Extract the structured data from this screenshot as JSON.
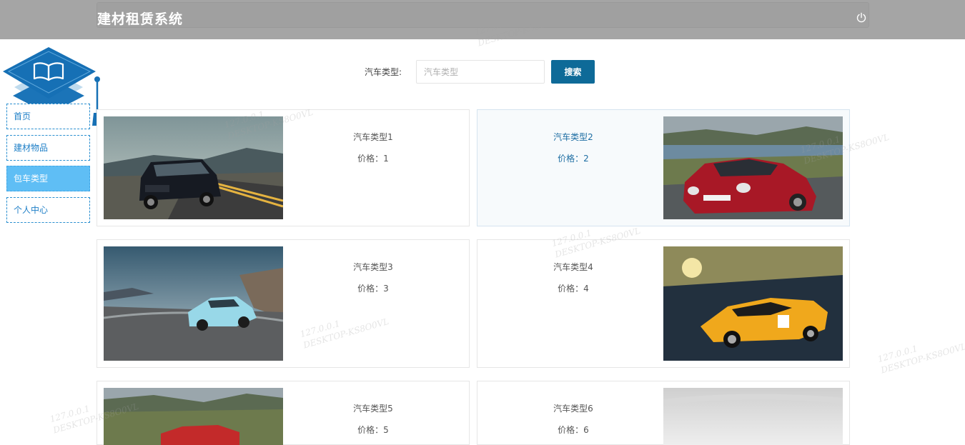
{
  "header": {
    "title": "建材租赁系统",
    "logout_icon": "power-icon"
  },
  "sidebar": {
    "items": [
      {
        "label": "首页",
        "active": false
      },
      {
        "label": "建材物品",
        "active": false
      },
      {
        "label": "包车类型",
        "active": true
      },
      {
        "label": "个人中心",
        "active": false
      }
    ]
  },
  "search": {
    "label": "汽车类型:",
    "placeholder": "汽车类型",
    "value": "",
    "button_label": "搜索"
  },
  "cards": [
    {
      "name": "汽车类型1",
      "price": "价格：1"
    },
    {
      "name": "汽车类型2",
      "price": "价格：2"
    },
    {
      "name": "汽车类型3",
      "price": "价格：3"
    },
    {
      "name": "汽车类型4",
      "price": "价格：4"
    },
    {
      "name": "汽车类型5",
      "price": "价格：5"
    },
    {
      "name": "汽车类型6",
      "price": "价格：6"
    }
  ],
  "watermark": {
    "ip": "127.0.0.1",
    "host": "DESKTOP-KS8O0VL"
  },
  "colors": {
    "accent": "#0e6a98",
    "sidebar_active": "#5fbef5",
    "header_bg": "#a5a5a5"
  }
}
